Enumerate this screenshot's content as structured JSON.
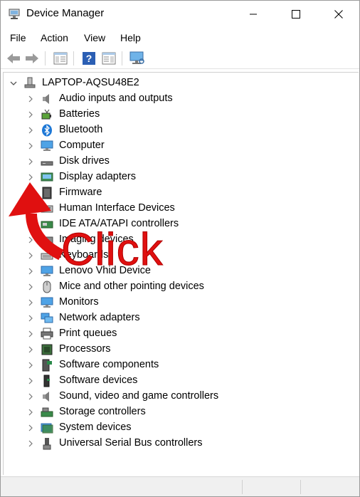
{
  "window": {
    "title": "Device Manager"
  },
  "menu": {
    "items": [
      "File",
      "Action",
      "View",
      "Help"
    ]
  },
  "tree": {
    "root": "LAPTOP-AQSU48E2",
    "categories": [
      {
        "label": "Audio inputs and outputs",
        "icon": "speaker-icon"
      },
      {
        "label": "Batteries",
        "icon": "battery-icon"
      },
      {
        "label": "Bluetooth",
        "icon": "bluetooth-icon"
      },
      {
        "label": "Computer",
        "icon": "computer-icon"
      },
      {
        "label": "Disk drives",
        "icon": "disk-drive-icon"
      },
      {
        "label": "Display adapters",
        "icon": "display-adapter-icon"
      },
      {
        "label": "Firmware",
        "icon": "firmware-icon"
      },
      {
        "label": "Human Interface Devices",
        "icon": "hid-icon"
      },
      {
        "label": "IDE ATA/ATAPI controllers",
        "icon": "ide-controller-icon"
      },
      {
        "label": "Imaging devices",
        "icon": "camera-icon"
      },
      {
        "label": "Keyboards",
        "icon": "keyboard-icon"
      },
      {
        "label": "Lenovo Vhid Device",
        "icon": "monitor-icon"
      },
      {
        "label": "Mice and other pointing devices",
        "icon": "mouse-icon"
      },
      {
        "label": "Monitors",
        "icon": "monitor-icon"
      },
      {
        "label": "Network adapters",
        "icon": "network-adapter-icon"
      },
      {
        "label": "Print queues",
        "icon": "printer-icon"
      },
      {
        "label": "Processors",
        "icon": "processor-icon"
      },
      {
        "label": "Software components",
        "icon": "software-component-icon"
      },
      {
        "label": "Software devices",
        "icon": "software-device-icon"
      },
      {
        "label": "Sound, video and game controllers",
        "icon": "speaker-icon"
      },
      {
        "label": "Storage controllers",
        "icon": "storage-controller-icon"
      },
      {
        "label": "System devices",
        "icon": "system-device-icon"
      },
      {
        "label": "Universal Serial Bus controllers",
        "icon": "usb-icon"
      }
    ]
  },
  "annotation": {
    "text": "Click",
    "color": "#e01010"
  },
  "colors": {
    "accent": "#1e78d6",
    "annotation_red": "#e01010"
  }
}
